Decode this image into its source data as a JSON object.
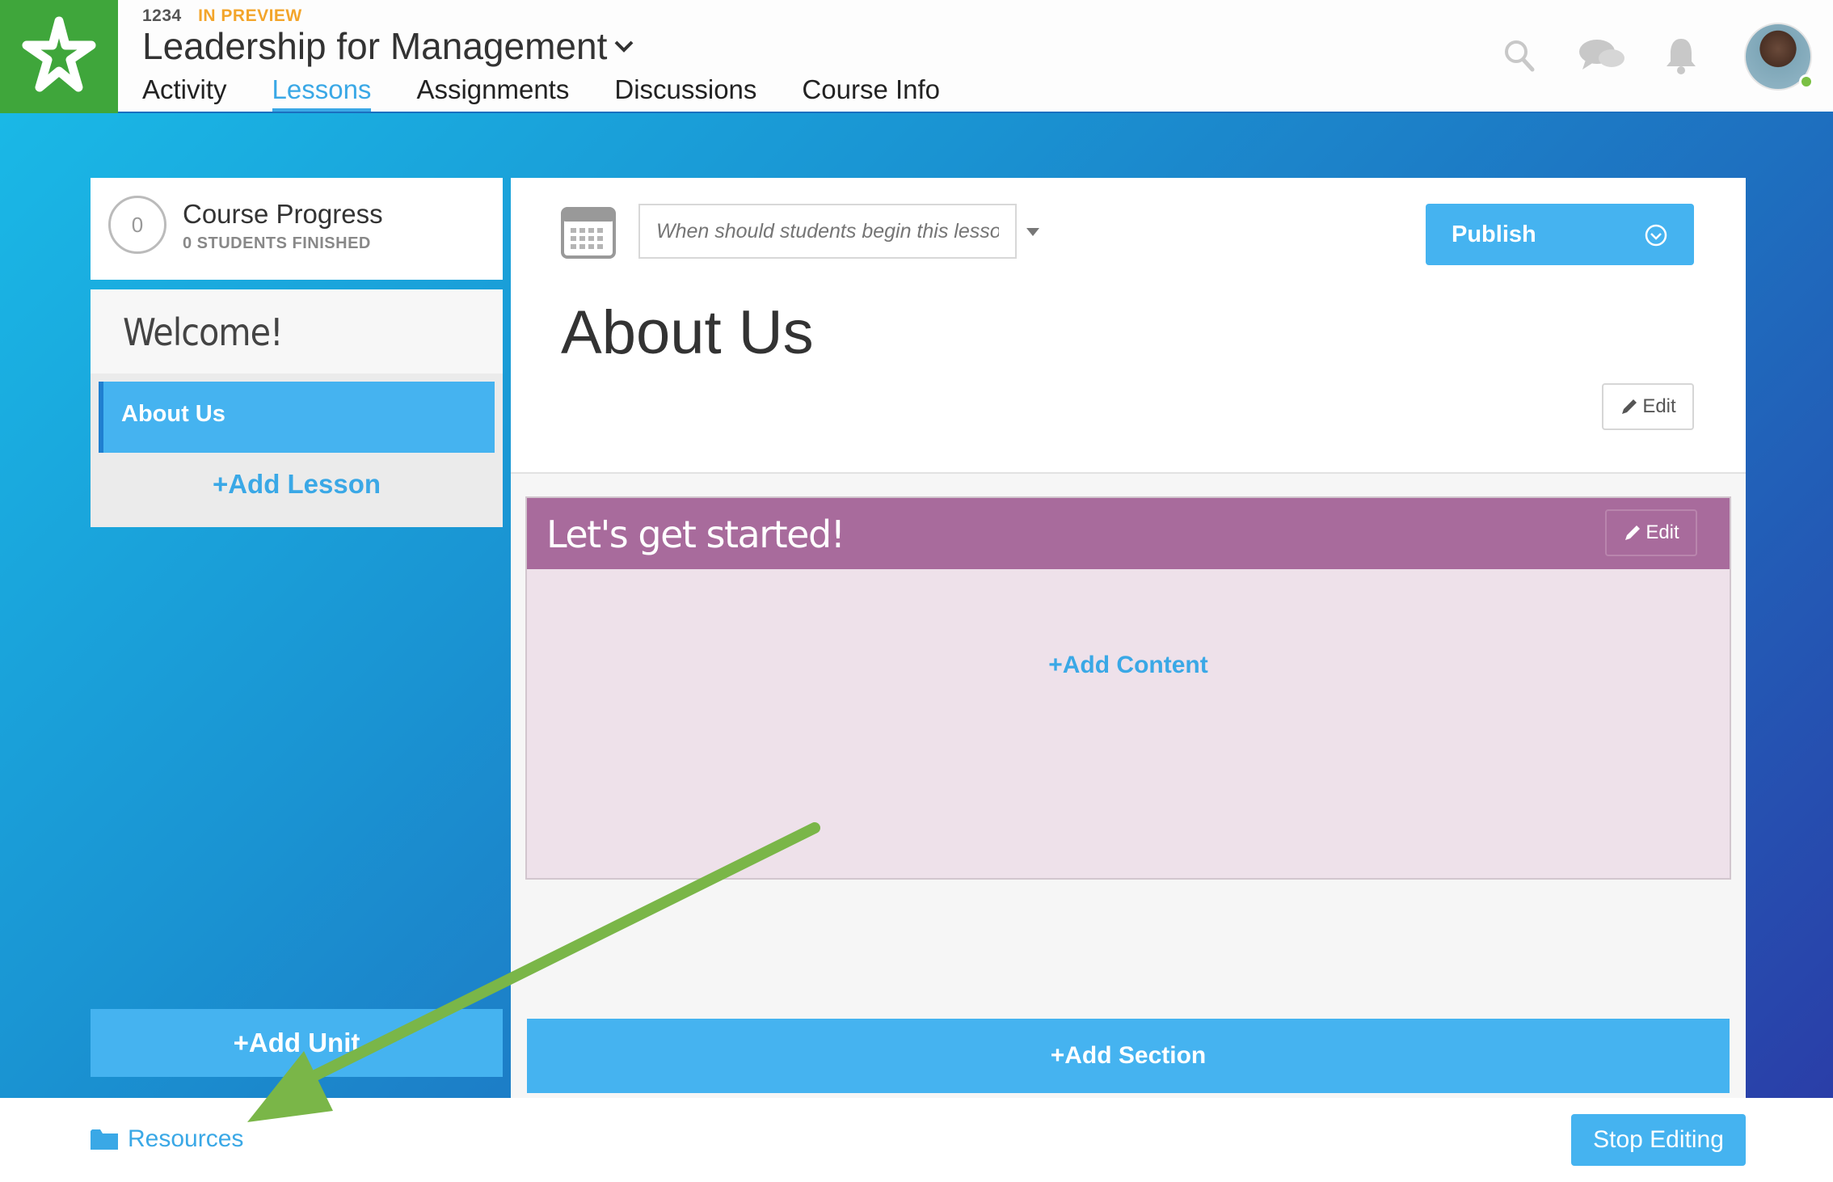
{
  "header": {
    "course_code": "1234",
    "preview_badge": "IN PREVIEW",
    "course_title": "Leadership for Management",
    "nav": [
      {
        "label": "Activity",
        "active": false
      },
      {
        "label": "Lessons",
        "active": true
      },
      {
        "label": "Assignments",
        "active": false
      },
      {
        "label": "Discussions",
        "active": false
      },
      {
        "label": "Course Info",
        "active": false
      }
    ],
    "icons": [
      "search-icon",
      "chat-icon",
      "bell-icon"
    ],
    "brand_color": "#3fa63b",
    "accent_color": "#45b3f0"
  },
  "sidebar": {
    "progress": {
      "count": "0",
      "title": "Course Progress",
      "subtitle": "0 STUDENTS FINISHED"
    },
    "unit_title": "Welcome!",
    "lessons": [
      {
        "label": "About Us",
        "selected": true
      }
    ],
    "add_lesson_label": "+Add Lesson",
    "add_unit_label": "+Add Unit"
  },
  "main": {
    "date_placeholder": "When should students begin this lesson?",
    "publish_label": "Publish",
    "lesson_title": "About Us",
    "edit_label": "Edit",
    "section": {
      "title": "Let's get started!",
      "edit_label": "Edit",
      "add_content_label": "+Add Content",
      "header_color": "#a86b9c"
    },
    "add_section_label": "+Add Section"
  },
  "footer": {
    "resources_label": "Resources",
    "stop_editing_label": "Stop Editing"
  },
  "annotation": {
    "arrow_color": "#7ab648"
  }
}
